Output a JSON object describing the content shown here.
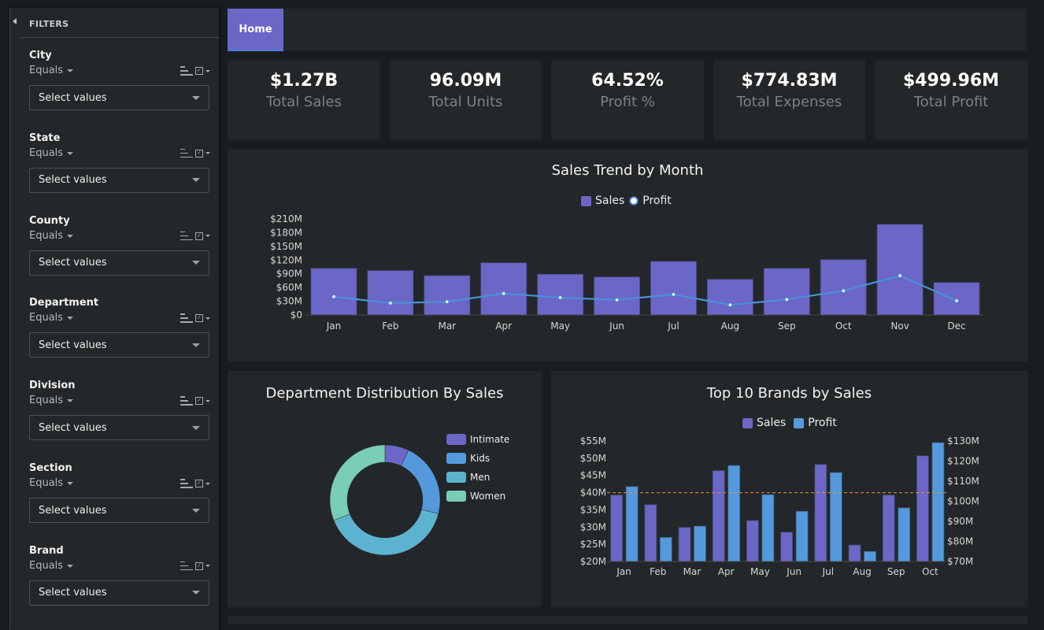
{
  "sidebar": {
    "title": "FILTERS",
    "filters": [
      {
        "label": "City",
        "operator": "Equals",
        "placeholder": "Select values"
      },
      {
        "label": "State",
        "operator": "Equals",
        "placeholder": "Select values"
      },
      {
        "label": "County",
        "operator": "Equals",
        "placeholder": "Select values"
      },
      {
        "label": "Department",
        "operator": "Equals",
        "placeholder": "Select values"
      },
      {
        "label": "Division",
        "operator": "Equals",
        "placeholder": "Select values"
      },
      {
        "label": "Section",
        "operator": "Equals",
        "placeholder": "Select values"
      },
      {
        "label": "Brand",
        "operator": "Equals",
        "placeholder": "Select values"
      }
    ]
  },
  "tabs": [
    {
      "label": "Home",
      "active": true
    }
  ],
  "kpis": [
    {
      "value": "$1.27B",
      "label": "Total Sales"
    },
    {
      "value": "96.09M",
      "label": "Total Units"
    },
    {
      "value": "64.52%",
      "label": "Profit %"
    },
    {
      "value": "$774.83M",
      "label": "Total Expenses"
    },
    {
      "value": "$499.96M",
      "label": "Total Profit"
    }
  ],
  "colors": {
    "sales": "#6c67c6",
    "profit_line": "#4a90d9",
    "profit_bar": "#5599dd",
    "reference": "#e8914a",
    "intimate": "#6c67c6",
    "kids": "#5599dd",
    "men": "#5cb3d0",
    "women": "#7acdb5"
  },
  "chart_data": [
    {
      "type": "bar",
      "title": "Sales Trend by Month",
      "legend": [
        "Sales",
        "Profit"
      ],
      "legend_position": "top",
      "categories": [
        "Jan",
        "Feb",
        "Mar",
        "Apr",
        "May",
        "Jun",
        "Jul",
        "Aug",
        "Sep",
        "Oct",
        "Nov",
        "Dec"
      ],
      "series": [
        {
          "name": "Sales",
          "kind": "bar",
          "values": [
            102,
            97,
            86,
            114,
            89,
            83,
            117,
            78,
            102,
            121,
            198,
            71
          ]
        },
        {
          "name": "Profit",
          "kind": "line",
          "values": [
            40,
            26,
            29,
            47,
            38,
            33,
            45,
            22,
            34,
            53,
            86,
            31
          ]
        }
      ],
      "yticks": [
        "$0",
        "$30M",
        "$60M",
        "$90M",
        "$120M",
        "$150M",
        "$180M",
        "$210M"
      ],
      "ylim": [
        0,
        210
      ],
      "units": "$M"
    },
    {
      "type": "pie",
      "title": "Department Distribution By Sales",
      "legend_position": "right",
      "labels": [
        "Intimate",
        "Kids",
        "Men",
        "Women"
      ],
      "values": [
        7,
        22,
        40,
        31
      ],
      "units": "%"
    },
    {
      "type": "bar",
      "title": "Top 10 Brands by Sales",
      "legend": [
        "Sales",
        "Profit"
      ],
      "legend_position": "top",
      "categories": [
        "Jan",
        "Feb",
        "Mar",
        "Apr",
        "May",
        "Jun",
        "Jul",
        "Aug",
        "Sep",
        "Oct"
      ],
      "series": [
        {
          "name": "Sales",
          "axis": "left",
          "values": [
            39.3,
            36.5,
            29.9,
            46.4,
            31.9,
            28.5,
            48.2,
            24.8,
            39.3,
            50.7
          ]
        },
        {
          "name": "Profit",
          "axis": "right",
          "values": [
            107.3,
            82,
            87.6,
            117.8,
            103.3,
            95,
            114.3,
            75,
            96.7,
            129.2
          ]
        }
      ],
      "yticks_left": [
        "$20M",
        "$25M",
        "$30M",
        "$35M",
        "$40M",
        "$45M",
        "$50M",
        "$55M"
      ],
      "ylim_left": [
        20,
        55
      ],
      "yticks_right": [
        "$70M",
        "$80M",
        "$90M",
        "$100M",
        "$110M",
        "$120M",
        "$130M"
      ],
      "ylim_right": [
        70,
        130
      ],
      "reference_line": 40,
      "units": "$M"
    }
  ]
}
